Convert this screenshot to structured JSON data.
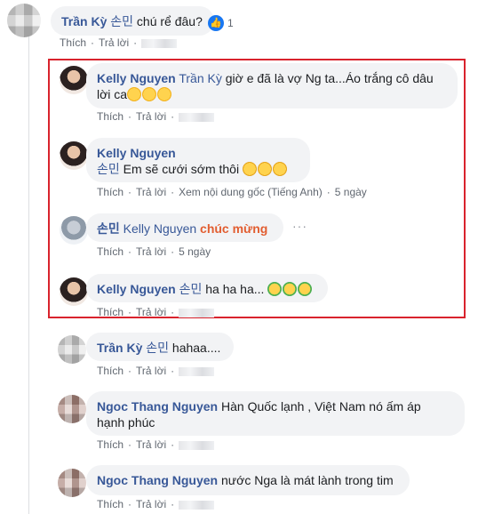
{
  "comments": [
    {
      "name": "Trần Kỳ",
      "tag": "손민",
      "text": " chú rể đâu?",
      "reactions": "1",
      "actions": [
        "Thích",
        "Trả lời"
      ]
    },
    {
      "name": "Kelly Nguyen",
      "tag": "Trần Kỳ",
      "text_line1": " giờ e đã là vợ Ng ta...Áo trắng cô dâu",
      "text_line2": "lời ca",
      "actions": [
        "Thích",
        "Trả lời"
      ]
    },
    {
      "name": "Kelly Nguyen",
      "tag": "손민",
      "text": " Em sẽ cưới sớm thôi",
      "actions": [
        "Thích",
        "Trả lời",
        "Xem nội dung gốc (Tiếng Anh)",
        "5 ngày"
      ]
    },
    {
      "name": "손민",
      "tag": "Kelly Nguyen",
      "highlight": "chúc mừng",
      "more": "···",
      "actions": [
        "Thích",
        "Trả lời",
        "5 ngày"
      ]
    },
    {
      "name": "Kelly Nguyen",
      "tag": "손민",
      "text": " ha ha ha...",
      "actions": [
        "Thích",
        "Trả lời"
      ]
    },
    {
      "name": "Trần Kỳ",
      "tag": "손민",
      "text": " hahaa....",
      "actions": [
        "Thích",
        "Trả lời"
      ]
    },
    {
      "name": "Ngoc Thang Nguyen",
      "text_line1": " Hàn Quốc lạnh , Việt Nam nó ấm áp",
      "text_line2": "hạnh phúc",
      "actions": [
        "Thích",
        "Trả lời"
      ]
    },
    {
      "name": "Ngoc Thang Nguyen",
      "text": " nước Nga là mát lành trong tim",
      "actions": [
        "Thích",
        "Trả lời"
      ]
    }
  ],
  "colors": {
    "name": "#385898",
    "highlight": "#e25d30",
    "box": "#d9232d"
  }
}
